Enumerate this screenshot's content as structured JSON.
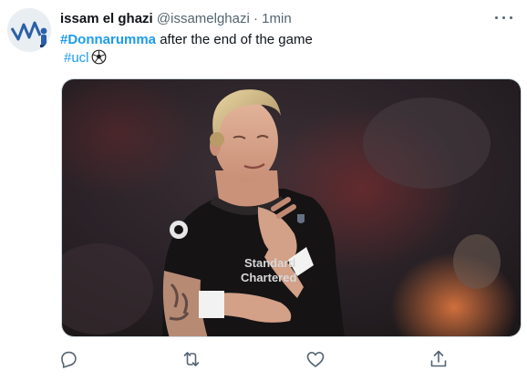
{
  "author": {
    "name": "issam el ghazi",
    "handle": "@issamelghazi",
    "separator": "·",
    "time": "1min"
  },
  "tweet": {
    "hashtag_main": "#Donnarumma",
    "text": " after the end of the game",
    "hashtag_second": "#ucl"
  },
  "media": {
    "shirt_text_line1": "Standard",
    "shirt_text_line2": "Chartered"
  },
  "colors": {
    "link": "#1d9bf0",
    "secondary": "#536471",
    "border": "#cfd9de"
  },
  "icons": {
    "more": "more-icon",
    "reply": "reply-icon",
    "retweet": "retweet-icon",
    "like": "like-icon",
    "share": "share-icon",
    "ball": "soccer-ball-icon"
  }
}
